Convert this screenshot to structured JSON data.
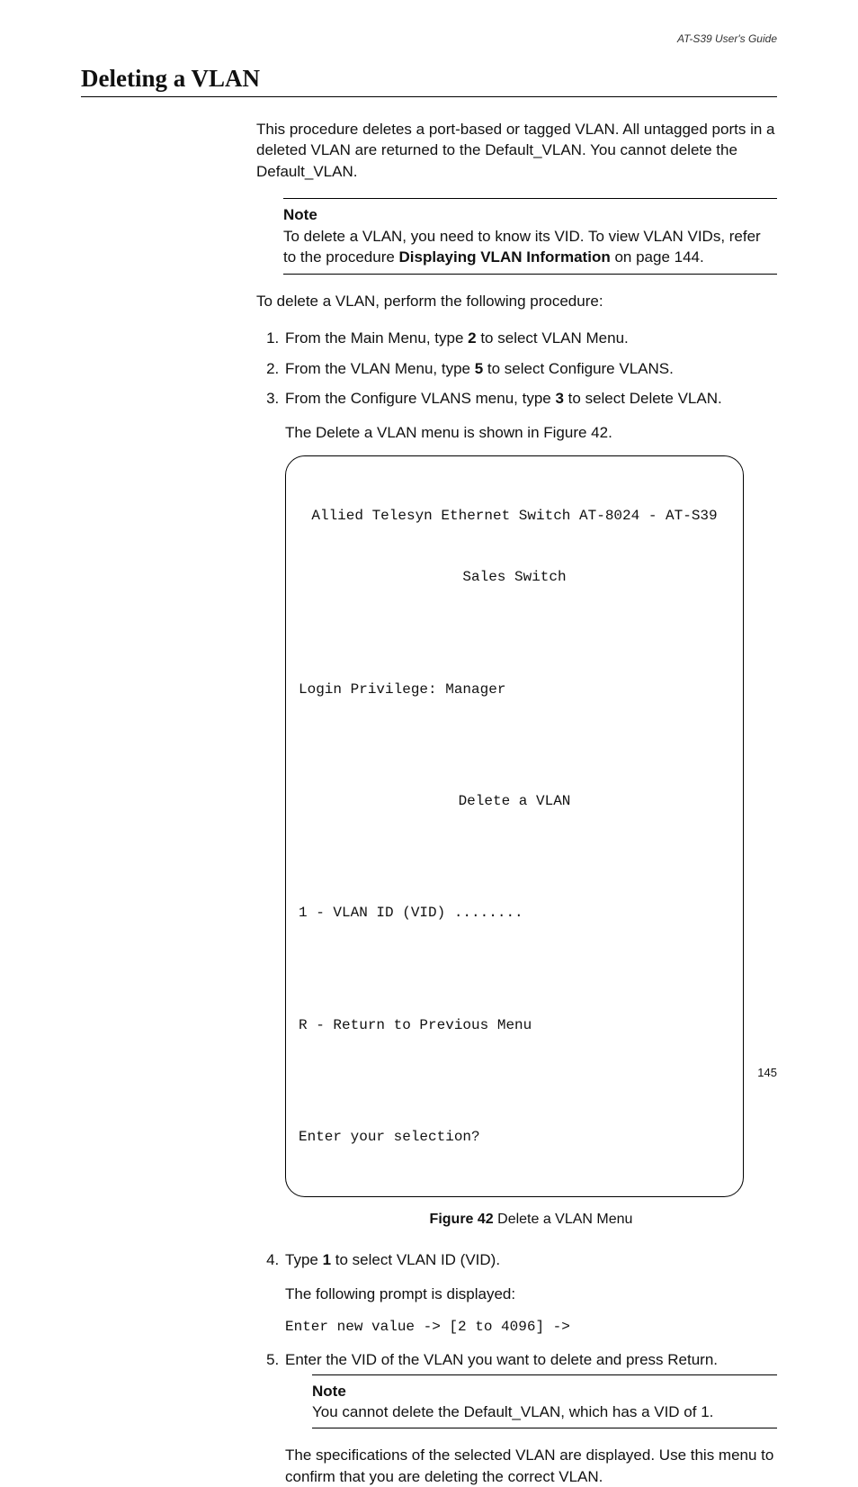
{
  "header": {
    "running": "AT-S39 User's Guide"
  },
  "title": "Deleting a VLAN",
  "intro": "This procedure deletes a port-based or tagged VLAN. All untagged ports in a deleted VLAN are returned to the Default_VLAN. You cannot delete the Default_VLAN.",
  "note1": {
    "label": "Note",
    "text_a": "To delete a VLAN, you need to know its VID. To view VLAN VIDs, refer to the procedure ",
    "bold": "Displaying VLAN Information",
    "text_b": " on page 144."
  },
  "lead": "To delete a VLAN, perform the following procedure:",
  "steps": {
    "s1a": "From the Main Menu, type ",
    "s1k": "2",
    "s1b": " to select VLAN Menu.",
    "s2a": "From the VLAN Menu, type ",
    "s2k": "5",
    "s2b": " to select Configure VLANS.",
    "s3a": "From the Configure VLANS menu, type ",
    "s3k": "3",
    "s3b": " to select Delete VLAN.",
    "s3sub": "The Delete a VLAN menu is shown in Figure 42.",
    "s4a": "Type ",
    "s4k": "1",
    "s4b": " to select VLAN ID (VID).",
    "s4sub": "The following prompt is displayed:",
    "s5": "Enter the VID of the VLAN you want to delete and press Return."
  },
  "terminal": {
    "l1": "Allied Telesyn Ethernet Switch AT-8024 - AT-S39",
    "l2": "Sales Switch",
    "l3": "Login Privilege: Manager",
    "l4": "Delete a VLAN",
    "l5": "1 - VLAN ID (VID) ........",
    "l6": "R - Return to Previous Menu",
    "l7": "Enter your selection?"
  },
  "figcap": {
    "bold": "Figure 42",
    "rest": "  Delete a VLAN Menu"
  },
  "prompt": "Enter new value -> [2 to 4096] ->",
  "note2": {
    "label": "Note",
    "text": "You cannot delete the Default_VLAN, which has a VID of 1."
  },
  "closing": "The specifications of the selected VLAN are displayed. Use this menu to confirm that you are deleting the correct VLAN.",
  "pagenum": "145"
}
